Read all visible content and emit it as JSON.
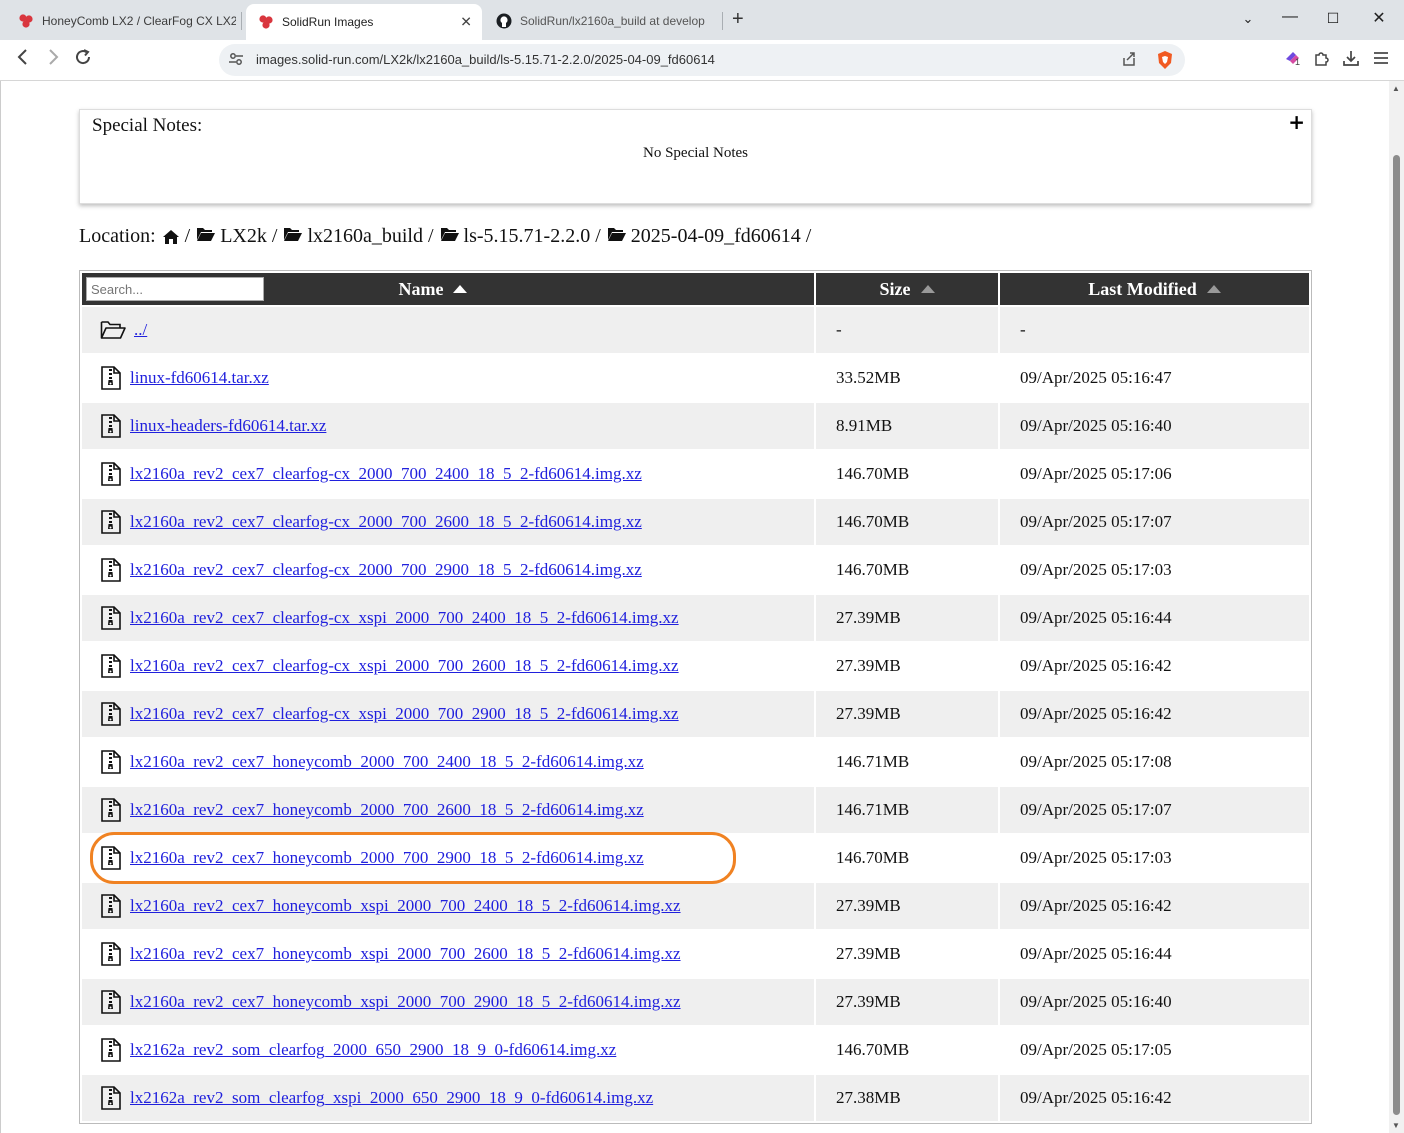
{
  "browser": {
    "tabs": [
      {
        "label": "HoneyComb LX2 / ClearFog CX LX2",
        "icon": "solidrun-logo-icon",
        "active": false
      },
      {
        "label": "SolidRun Images",
        "icon": "solidrun-logo-icon",
        "active": true
      },
      {
        "label": "SolidRun/lx2160a_build at develop",
        "icon": "github-icon",
        "active": false
      }
    ],
    "url": "images.solid-run.com/LX2k/lx2160a_build/ls-5.15.71-2.2.0/2025-04-09_fd60614",
    "extension_badge": "1"
  },
  "notes": {
    "title": "Special Notes:",
    "text": "No Special Notes",
    "toggle": "+"
  },
  "location": {
    "label": "Location:",
    "crumbs": [
      "LX2k",
      "lx2160a_build",
      "ls-5.15.71-2.2.0",
      "2025-04-09_fd60614"
    ],
    "separator": "/"
  },
  "table": {
    "search_placeholder": "Search...",
    "headers": {
      "name": "Name",
      "size": "Size",
      "modified": "Last Modified"
    },
    "parent": {
      "name": "../",
      "size": "-",
      "modified": "-"
    },
    "rows": [
      {
        "name": "linux-fd60614.tar.xz",
        "size": "33.52MB",
        "modified": "09/Apr/2025 05:16:47"
      },
      {
        "name": "linux-headers-fd60614.tar.xz",
        "size": "8.91MB",
        "modified": "09/Apr/2025 05:16:40"
      },
      {
        "name": "lx2160a_rev2_cex7_clearfog-cx_2000_700_2400_18_5_2-fd60614.img.xz",
        "size": "146.70MB",
        "modified": "09/Apr/2025 05:17:06"
      },
      {
        "name": "lx2160a_rev2_cex7_clearfog-cx_2000_700_2600_18_5_2-fd60614.img.xz",
        "size": "146.70MB",
        "modified": "09/Apr/2025 05:17:07"
      },
      {
        "name": "lx2160a_rev2_cex7_clearfog-cx_2000_700_2900_18_5_2-fd60614.img.xz",
        "size": "146.70MB",
        "modified": "09/Apr/2025 05:17:03"
      },
      {
        "name": "lx2160a_rev2_cex7_clearfog-cx_xspi_2000_700_2400_18_5_2-fd60614.img.xz",
        "size": "27.39MB",
        "modified": "09/Apr/2025 05:16:44"
      },
      {
        "name": "lx2160a_rev2_cex7_clearfog-cx_xspi_2000_700_2600_18_5_2-fd60614.img.xz",
        "size": "27.39MB",
        "modified": "09/Apr/2025 05:16:42"
      },
      {
        "name": "lx2160a_rev2_cex7_clearfog-cx_xspi_2000_700_2900_18_5_2-fd60614.img.xz",
        "size": "27.39MB",
        "modified": "09/Apr/2025 05:16:42"
      },
      {
        "name": "lx2160a_rev2_cex7_honeycomb_2000_700_2400_18_5_2-fd60614.img.xz",
        "size": "146.71MB",
        "modified": "09/Apr/2025 05:17:08"
      },
      {
        "name": "lx2160a_rev2_cex7_honeycomb_2000_700_2600_18_5_2-fd60614.img.xz",
        "size": "146.71MB",
        "modified": "09/Apr/2025 05:17:07"
      },
      {
        "name": "lx2160a_rev2_cex7_honeycomb_2000_700_2900_18_5_2-fd60614.img.xz",
        "size": "146.70MB",
        "modified": "09/Apr/2025 05:17:03"
      },
      {
        "name": "lx2160a_rev2_cex7_honeycomb_xspi_2000_700_2400_18_5_2-fd60614.img.xz",
        "size": "27.39MB",
        "modified": "09/Apr/2025 05:16:42"
      },
      {
        "name": "lx2160a_rev2_cex7_honeycomb_xspi_2000_700_2600_18_5_2-fd60614.img.xz",
        "size": "27.39MB",
        "modified": "09/Apr/2025 05:16:44"
      },
      {
        "name": "lx2160a_rev2_cex7_honeycomb_xspi_2000_700_2900_18_5_2-fd60614.img.xz",
        "size": "27.39MB",
        "modified": "09/Apr/2025 05:16:40"
      },
      {
        "name": "lx2162a_rev2_som_clearfog_2000_650_2900_18_9_0-fd60614.img.xz",
        "size": "146.70MB",
        "modified": "09/Apr/2025 05:17:05"
      },
      {
        "name": "lx2162a_rev2_som_clearfog_xspi_2000_650_2900_18_9_0-fd60614.img.xz",
        "size": "27.38MB",
        "modified": "09/Apr/2025 05:16:42"
      }
    ]
  },
  "colors": {
    "link": "#2020dd",
    "header_bg": "#333333",
    "highlight": "#f08222",
    "row_alt": "#efefef"
  }
}
